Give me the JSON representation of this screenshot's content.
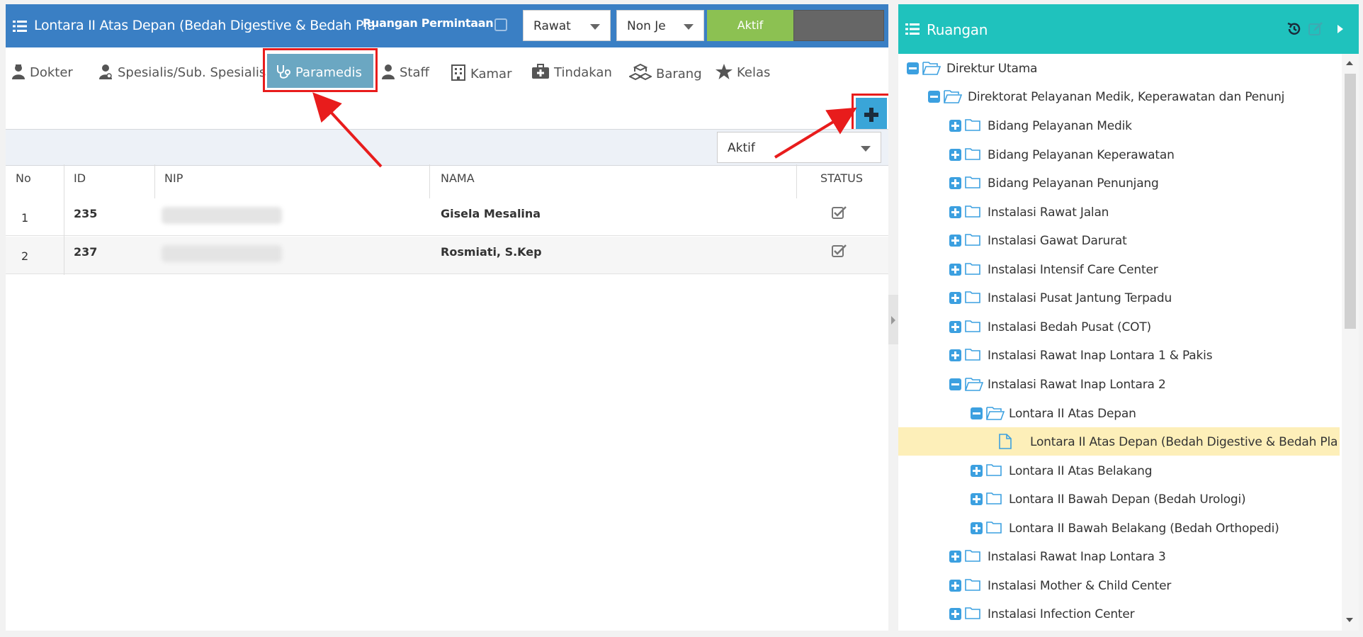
{
  "left_panel": {
    "title": "Lontara II Atas Depan (Bedah Digestive & Bedah Pla",
    "request_label": "Ruangan Permintaan",
    "select_rawat": "Rawat",
    "select_jenis": "Non Je",
    "aktif_button": "Aktif",
    "tabs": [
      {
        "label": "Dokter",
        "icon": "doctor-icon"
      },
      {
        "label": "Spesialis/Sub. Spesialis",
        "icon": "specialist-icon"
      },
      {
        "label": "Paramedis",
        "icon": "stethoscope-icon",
        "active": true
      },
      {
        "label": "Staff",
        "icon": "user-icon"
      },
      {
        "label": "Kamar",
        "icon": "building-icon"
      },
      {
        "label": "Tindakan",
        "icon": "medkit-icon"
      },
      {
        "label": "Barang",
        "icon": "cubes-icon"
      },
      {
        "label": "Kelas",
        "icon": "star-icon"
      }
    ],
    "status_filter": "Aktif",
    "table": {
      "headers": [
        "No",
        "ID",
        "NIP",
        "NAMA",
        "STATUS"
      ],
      "rows": [
        {
          "no": "1",
          "id": "235",
          "nama": "Gisela Mesalina",
          "status": true
        },
        {
          "no": "2",
          "id": "237",
          "nama": "Rosmiati, S.Kep",
          "status": true
        }
      ]
    }
  },
  "right_panel": {
    "title": "Ruangan",
    "tree": [
      "Direktur Utama",
      "Direktorat Pelayanan Medik, Keperawatan dan Penunj",
      "Bidang Pelayanan Medik",
      "Bidang Pelayanan Keperawatan",
      "Bidang Pelayanan Penunjang",
      "Instalasi Rawat Jalan",
      "Instalasi Gawat Darurat",
      "Instalasi Intensif Care Center",
      "Instalasi Pusat Jantung Terpadu",
      "Instalasi Bedah Pusat (COT)",
      "Instalasi Rawat Inap Lontara 1 & Pakis",
      "Instalasi Rawat Inap Lontara 2",
      "Lontara II Atas Depan",
      "Lontara II Atas Depan (Bedah Digestive & Bedah Pla",
      "Lontara II Atas Belakang",
      "Lontara II Bawah Depan (Bedah Urologi)",
      "Lontara II Bawah Belakang (Bedah Orthopedi)",
      "Instalasi Rawat Inap Lontara 3",
      "Instalasi Mother & Child Center",
      "Instalasi Infection Center"
    ]
  },
  "colors": {
    "left_header": "#3a7fc4",
    "right_header": "#1fc2bd",
    "active_tab": "#6ba7c2",
    "aktif_green": "#8cc152",
    "annotation_red": "#e81c1c",
    "tree_toggle": "#3ca0e0",
    "selected_row": "#fdefb9"
  }
}
